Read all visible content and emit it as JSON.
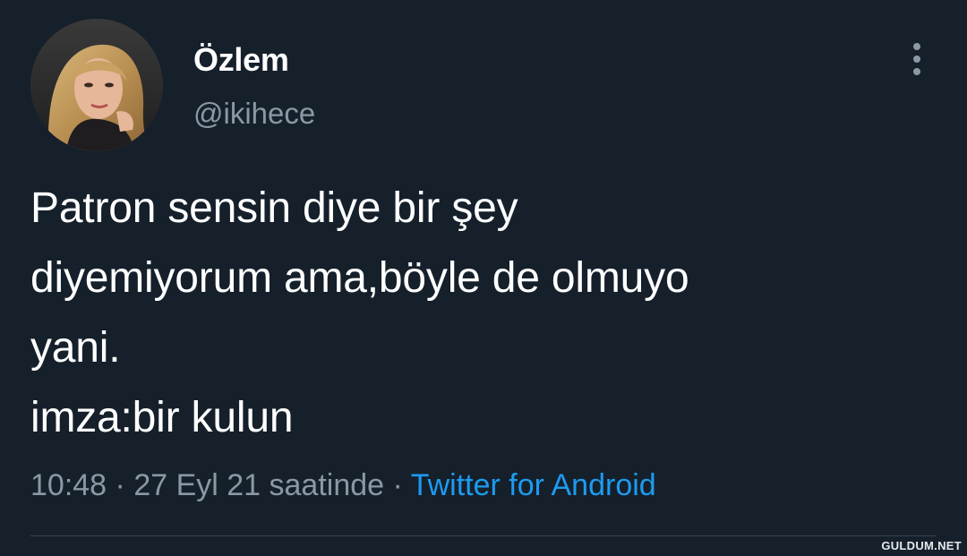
{
  "user": {
    "display_name": "Özlem",
    "handle": "@ikihece"
  },
  "tweet": {
    "lines": [
      "Patron sensin diye bir şey",
      "diyemiyorum ama,böyle de olmuyo",
      "yani.",
      "imza:bir kulun"
    ]
  },
  "meta": {
    "time": "10:48",
    "separator": " · ",
    "date": "27 Eyl 21 saatinde",
    "source": "Twitter for Android"
  },
  "watermark": "GULDUM.NET",
  "colors": {
    "background": "#15202b",
    "text": "#ffffff",
    "secondary": "#8b98a5",
    "accent": "#1d9bf0",
    "divider": "#38444d"
  },
  "icons": {
    "more": "more-vertical-icon"
  }
}
